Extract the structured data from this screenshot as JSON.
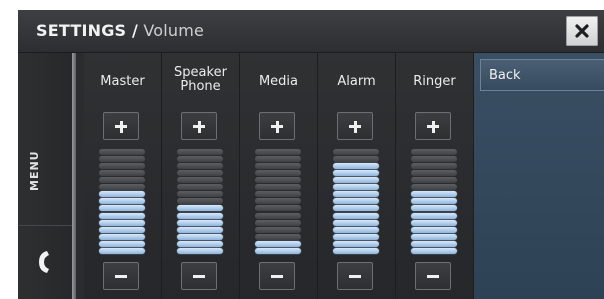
{
  "header": {
    "title_bold": "SETTINGS /",
    "title_rest": " Volume",
    "close_icon": "close-x-icon"
  },
  "sidebar": {
    "menu_label": "MENU",
    "phone_icon": "phone-handset-icon"
  },
  "volume": {
    "levels_total": 15,
    "channels": [
      {
        "label_line1": "Master",
        "label_line2": "",
        "level": 9
      },
      {
        "label_line1": "Speaker",
        "label_line2": "Phone",
        "level": 7
      },
      {
        "label_line1": "Media",
        "label_line2": "",
        "level": 2
      },
      {
        "label_line1": "Alarm",
        "label_line2": "",
        "level": 13
      },
      {
        "label_line1": "Ringer",
        "label_line2": "",
        "level": 9
      }
    ],
    "increase_icon": "plus-icon",
    "decrease_icon": "minus-icon"
  },
  "panel": {
    "back_label": "Back"
  },
  "colors": {
    "active_bar": "#a9c9ec",
    "inactive_bar": "#4f5154",
    "panel_blue": "#34495d"
  }
}
